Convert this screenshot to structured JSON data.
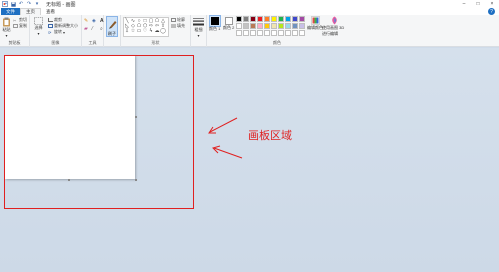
{
  "titlebar": {
    "title": "无标题 - 画图",
    "qa_items": [
      "save-icon",
      "undo-icon",
      "redo-icon"
    ],
    "controls": [
      "–",
      "□",
      "×"
    ]
  },
  "tabs": [
    {
      "label": "文件",
      "kind": "file"
    },
    {
      "label": "主页",
      "kind": "active"
    },
    {
      "label": "查看",
      "kind": "normal"
    }
  ],
  "help_label": "?",
  "ribbon": {
    "clipboard": {
      "paste": "粘贴",
      "cut": "剪切",
      "copy": "复制",
      "label": "剪贴板"
    },
    "image": {
      "select": "选择",
      "crop": "裁剪",
      "resize": "重新调整大小",
      "rotate": "旋转",
      "label": "图像"
    },
    "tools": {
      "label": "工具"
    },
    "brushes": {
      "label": "刷子"
    },
    "shapes": {
      "outline": "轮廓",
      "fill": "填充",
      "label": "形状"
    },
    "size": {
      "label": "粗细"
    },
    "colors": {
      "color1": "颜色 1",
      "color2": "颜色 2",
      "edit": "编辑颜色",
      "paint3d": "使用画图 3D 进行编辑",
      "label": "颜色"
    }
  },
  "palette_top": [
    "#000000",
    "#7f7f7f",
    "#880015",
    "#ed1c24",
    "#ff7f27",
    "#fff200",
    "#22b14c",
    "#00a2e8",
    "#3f48cc",
    "#a349a4"
  ],
  "palette_bottom": [
    "#ffffff",
    "#c3c3c3",
    "#b97a57",
    "#ffaec9",
    "#ffc90e",
    "#efe4b0",
    "#b5e61d",
    "#99d9ea",
    "#7092be",
    "#c8bfe7"
  ],
  "palette_extra": [
    "#ffffff",
    "#ffffff",
    "#ffffff",
    "#ffffff",
    "#ffffff",
    "#ffffff",
    "#ffffff",
    "#ffffff",
    "#ffffff",
    "#ffffff"
  ],
  "annotation": "画板区域"
}
